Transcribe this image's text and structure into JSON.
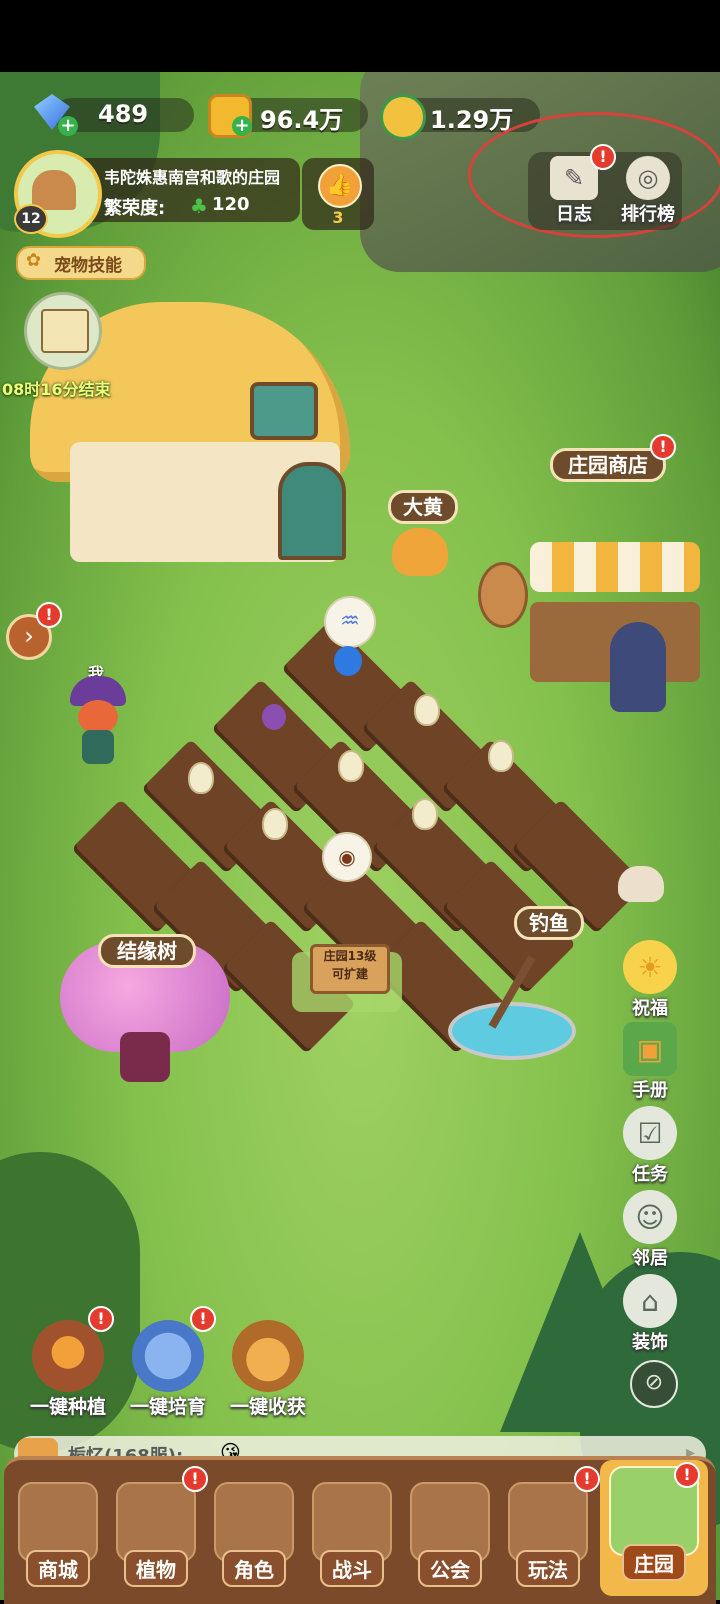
{
  "resources": {
    "gems": "489",
    "gold": "96.4万",
    "carrot_coins": "1.29万"
  },
  "profile": {
    "level": "12",
    "manor_name": "韦陀姝惠南宫和歌的庄园",
    "prosperity_label": "繁荣度:",
    "prosperity_value": "120",
    "likes": "3"
  },
  "top_right": {
    "log_label": "日志",
    "ranking_label": "排行榜"
  },
  "pet_skill_label": "宠物技能",
  "event_timer": "08时16分结束",
  "map_labels": {
    "dog_name": "大黄",
    "shop": "庄园商店",
    "me": "我",
    "tree": "结缘树",
    "fishing": "钓鱼",
    "expand_sign_line1": "庄园13级",
    "expand_sign_line2": "可扩建"
  },
  "side_buttons": [
    {
      "label": "祝福",
      "icon": "sun-icon"
    },
    {
      "label": "手册",
      "icon": "book-icon"
    },
    {
      "label": "任务",
      "icon": "checklist-icon"
    },
    {
      "label": "邻居",
      "icon": "neighbor-icon"
    },
    {
      "label": "装饰",
      "icon": "decor-icon"
    }
  ],
  "quick_actions": [
    {
      "label": "一键种植",
      "icon": "plant-icon"
    },
    {
      "label": "一键培育",
      "icon": "watering-can-icon"
    },
    {
      "label": "一键收获",
      "icon": "basket-icon"
    }
  ],
  "chat": {
    "channel": "栀忆(168服):",
    "message": "😘"
  },
  "bottom_nav": [
    {
      "label": "商城"
    },
    {
      "label": "植物"
    },
    {
      "label": "角色"
    },
    {
      "label": "战斗"
    },
    {
      "label": "公会"
    },
    {
      "label": "玩法"
    },
    {
      "label": "庄园"
    }
  ],
  "colors": {
    "grass": "#84c04c",
    "soil": "#6f4326",
    "badge_red": "#e53b2f",
    "nav_brown": "#7a4a2a",
    "highlight_circle": "#d9423a"
  }
}
